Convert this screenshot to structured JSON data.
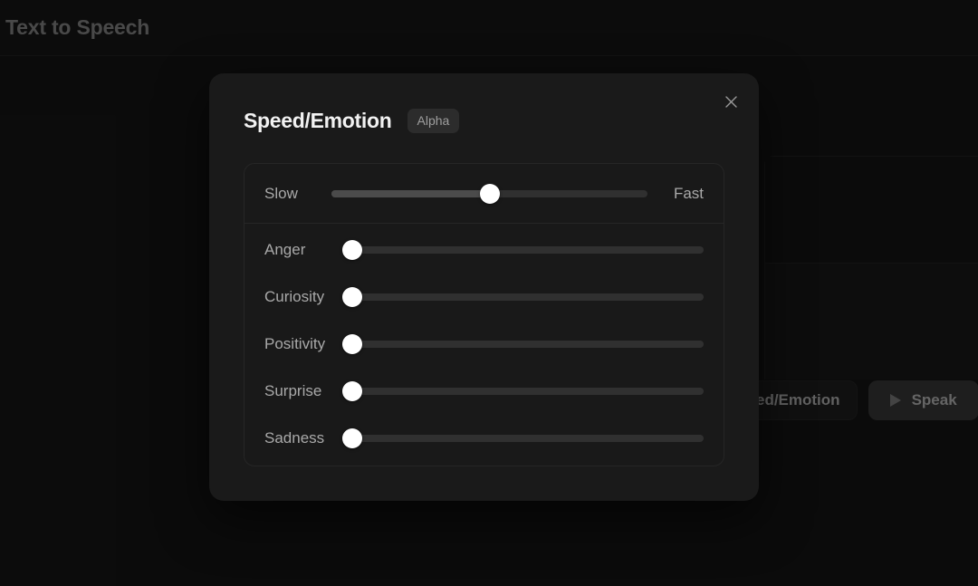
{
  "app": {
    "title": "Text to Speech"
  },
  "background": {
    "secondary_button_label": "ed/Emotion",
    "speak_button_label": "Speak",
    "play_icon": "play-icon"
  },
  "modal": {
    "title": "Speed/Emotion",
    "badge": "Alpha",
    "close_icon": "close-icon",
    "speed": {
      "left_label": "Slow",
      "right_label": "Fast",
      "value": 50,
      "min": 0,
      "max": 100
    },
    "emotions": [
      {
        "label": "Anger",
        "value": 0,
        "min": 0,
        "max": 100
      },
      {
        "label": "Curiosity",
        "value": 0,
        "min": 0,
        "max": 100
      },
      {
        "label": "Positivity",
        "value": 0,
        "min": 0,
        "max": 100
      },
      {
        "label": "Surprise",
        "value": 0,
        "min": 0,
        "max": 100
      },
      {
        "label": "Sadness",
        "value": 0,
        "min": 0,
        "max": 100
      }
    ]
  },
  "colors": {
    "page_bg": "#111111",
    "modal_bg": "#1a1a1a",
    "panel_bg": "#191919",
    "track": "#303030",
    "track_fill": "#4b4b4b",
    "thumb": "#ffffff",
    "text_muted": "#a9a9a9",
    "text_primary": "#f2f2f2"
  }
}
